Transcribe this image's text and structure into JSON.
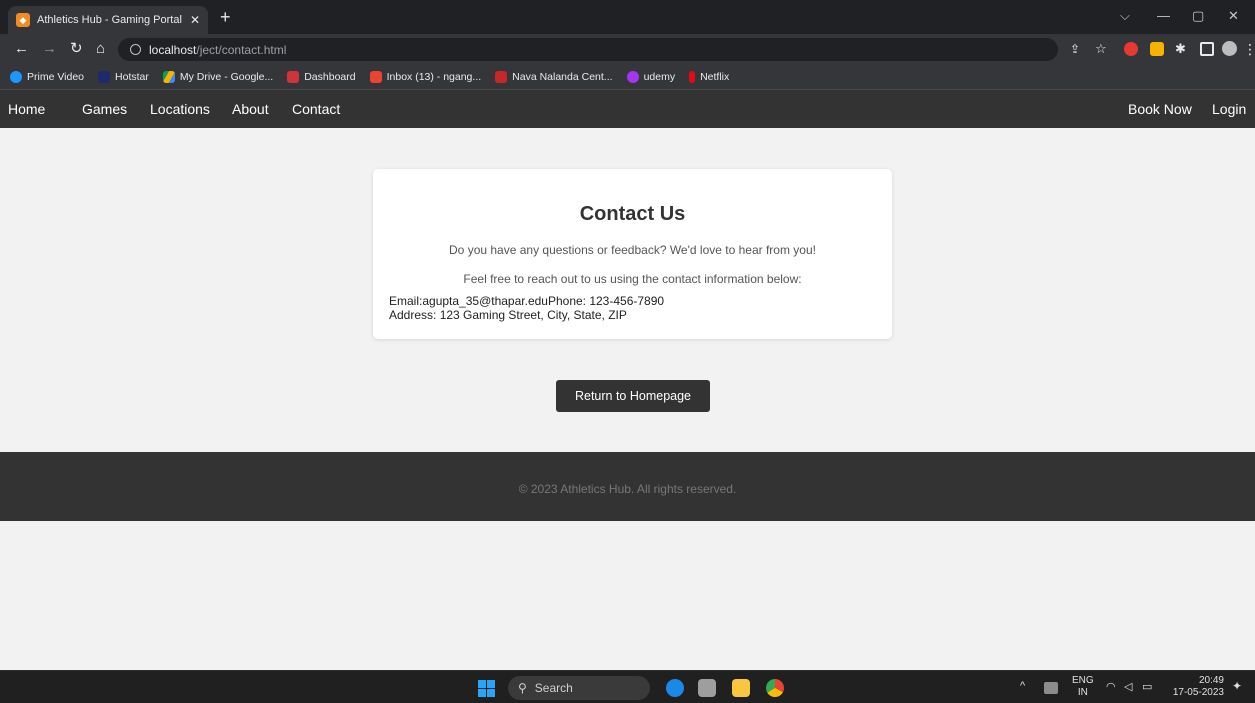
{
  "browser": {
    "tab_title": "Athletics Hub - Gaming Portal | C",
    "tab_close": "✕",
    "new_tab": "+",
    "url_host": "localhost",
    "url_path": "/ject/contact.html",
    "bookmarks": [
      "Prime Video",
      "Hotstar",
      "My Drive - Google...",
      "Dashboard",
      "Inbox (13) - ngang...",
      "Nava Nalanda Cent...",
      "udemy",
      "Netflix"
    ],
    "icons": [
      "back-icon",
      "forward-icon",
      "reload-icon",
      "home-icon",
      "share-icon",
      "star-icon",
      "extensions-icon",
      "sidebar-icon",
      "profile-icon",
      "menu-icon"
    ]
  },
  "nav": {
    "home": "Home",
    "games": "Games",
    "locations": "Locations",
    "about": "About",
    "contact": "Contact",
    "book_now": "Book Now",
    "login": "Login"
  },
  "contact": {
    "title": "Contact Us",
    "intro": "Do you have any questions or feedback? We'd love to hear from you!",
    "reach_out": "Feel free to reach out to us using the contact information below:",
    "email_phone": "Email:agupta_35@thapar.eduPhone: 123-456-7890",
    "address": "Address: 123 Gaming Street, City, State, ZIP"
  },
  "return_button": "Return to Homepage",
  "footer": {
    "copyright": "© 2023 Athletics Hub. All rights reserved."
  },
  "taskbar": {
    "search_label": "Search",
    "lang_top": "ENG",
    "lang_bottom": "IN",
    "time": "20:49",
    "date": "17-05-2023"
  },
  "colors": {
    "nav_bg": "#333333",
    "page_bg": "#f2f2f2",
    "card_bg": "#ffffff",
    "footer_text": "#777777"
  }
}
